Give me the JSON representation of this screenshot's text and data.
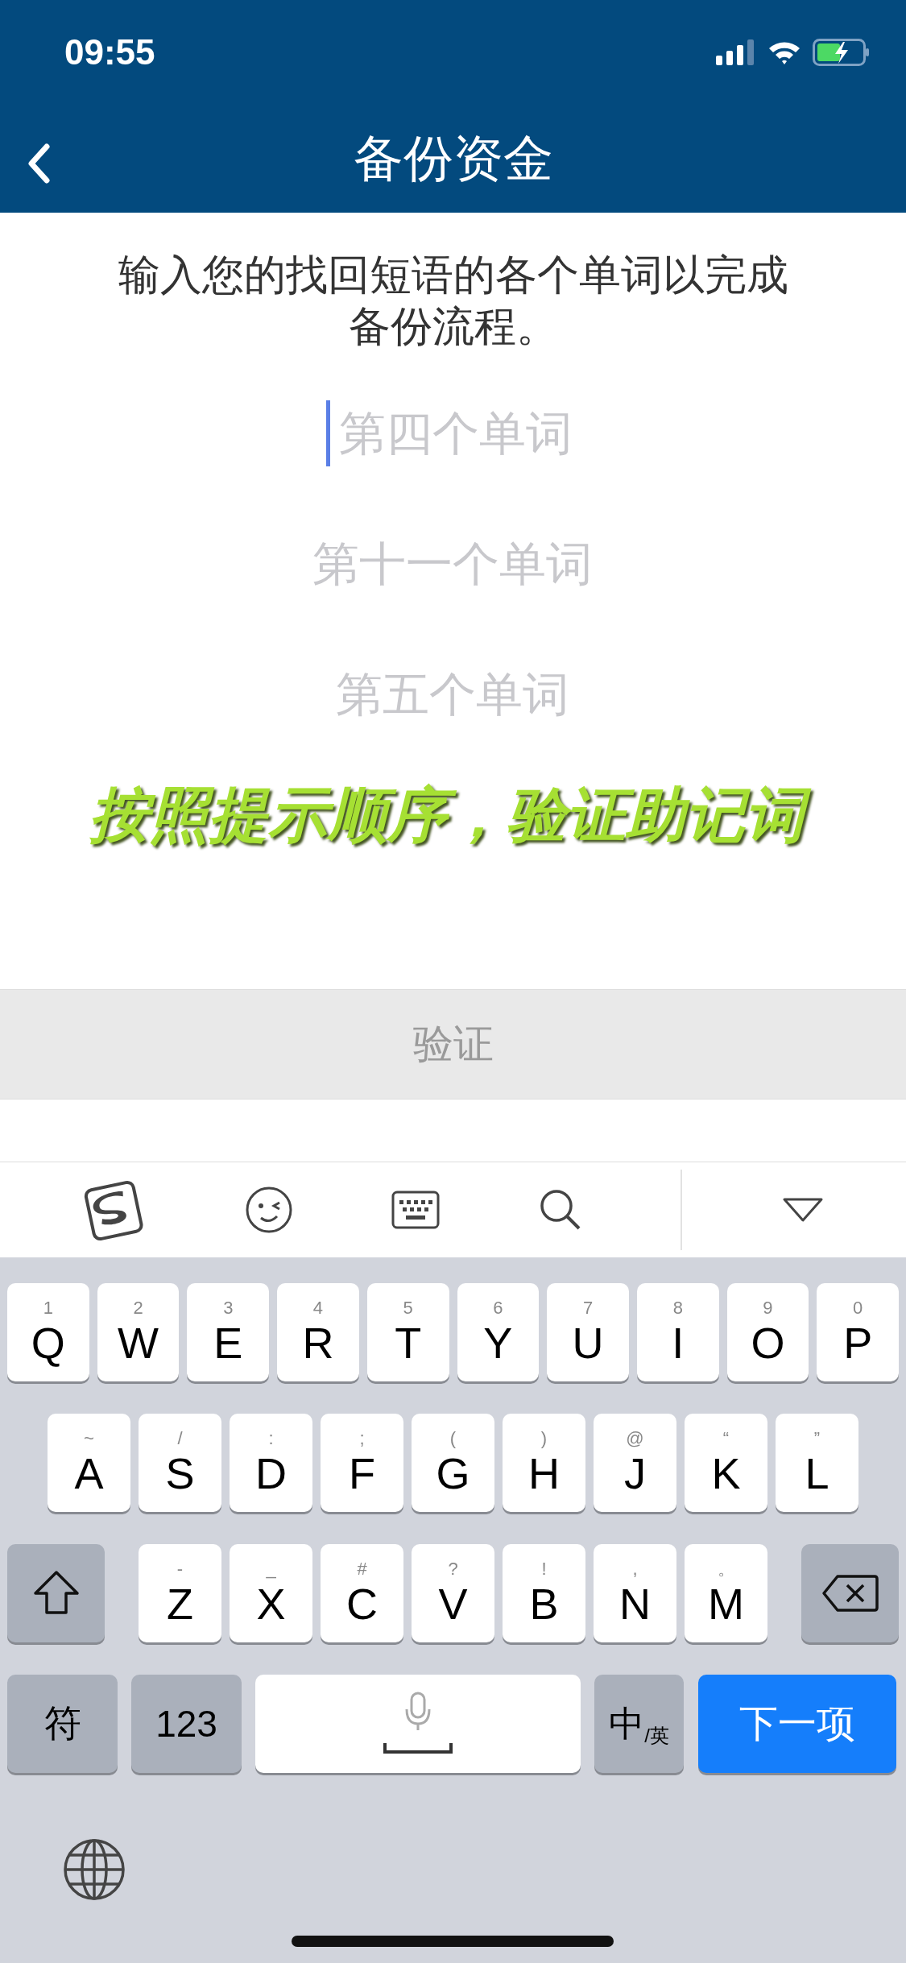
{
  "status_bar": {
    "time": "09:55"
  },
  "header": {
    "title": "备份资金"
  },
  "instruction": "输入您的找回短语的各个单词以完成备份流程。",
  "fields": [
    {
      "placeholder": "第四个单词",
      "focused": true
    },
    {
      "placeholder": "第十一个单词",
      "focused": false
    },
    {
      "placeholder": "第五个单词",
      "focused": false
    }
  ],
  "annotation": "按照提示顺序，验证助记词",
  "verify_button": {
    "label": "验证",
    "disabled": true
  },
  "keyboard": {
    "letter_rows": [
      [
        {
          "label": "Q",
          "hint": "1"
        },
        {
          "label": "W",
          "hint": "2"
        },
        {
          "label": "E",
          "hint": "3"
        },
        {
          "label": "R",
          "hint": "4"
        },
        {
          "label": "T",
          "hint": "5"
        },
        {
          "label": "Y",
          "hint": "6"
        },
        {
          "label": "U",
          "hint": "7"
        },
        {
          "label": "I",
          "hint": "8"
        },
        {
          "label": "O",
          "hint": "9"
        },
        {
          "label": "P",
          "hint": "0"
        }
      ],
      [
        {
          "label": "A",
          "hint": "~"
        },
        {
          "label": "S",
          "hint": "/"
        },
        {
          "label": "D",
          "hint": ":"
        },
        {
          "label": "F",
          "hint": ";"
        },
        {
          "label": "G",
          "hint": "("
        },
        {
          "label": "H",
          "hint": ")"
        },
        {
          "label": "J",
          "hint": "@"
        },
        {
          "label": "K",
          "hint": "“"
        },
        {
          "label": "L",
          "hint": "”"
        }
      ],
      [
        {
          "label": "Z",
          "hint": "-"
        },
        {
          "label": "X",
          "hint": "_"
        },
        {
          "label": "C",
          "hint": "#"
        },
        {
          "label": "V",
          "hint": "?"
        },
        {
          "label": "B",
          "hint": "!"
        },
        {
          "label": "N",
          "hint": ","
        },
        {
          "label": "M",
          "hint": "。"
        }
      ]
    ],
    "symbols_key": "符",
    "numbers_key": "123",
    "lang_primary": "中",
    "lang_secondary": "/英",
    "return_key": "下一项"
  }
}
